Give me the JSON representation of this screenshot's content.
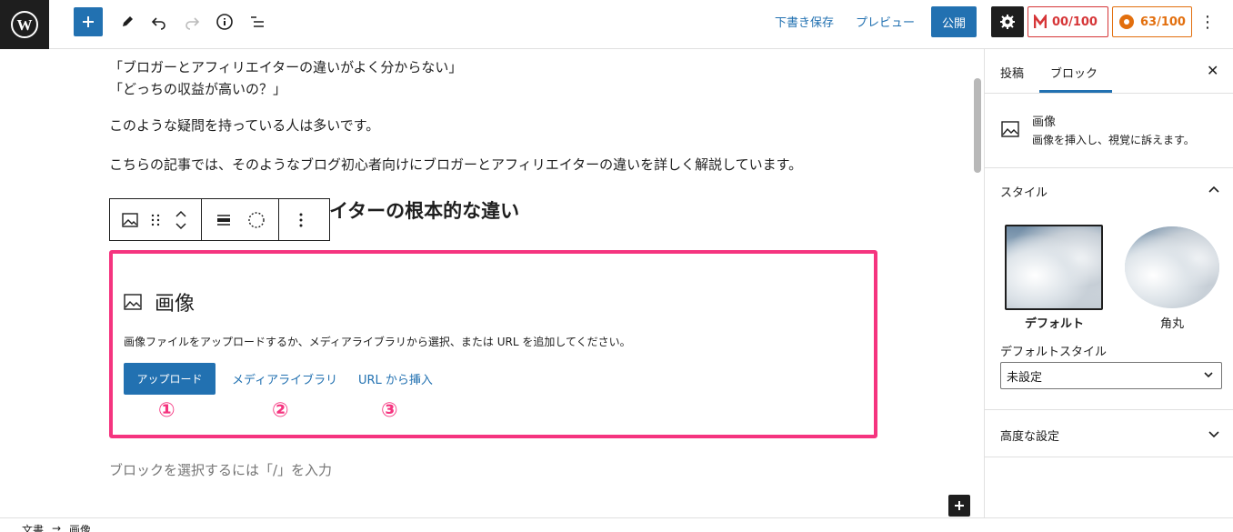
{
  "topbar": {
    "save_draft": "下書き保存",
    "preview": "プレビュー",
    "publish": "公開",
    "score_m": "00/100",
    "score_y": "63/100"
  },
  "content": {
    "lines": [
      "「ブロガーとアフィリエイターの違いがよく分からない」",
      "「どっちの収益が高いの？」",
      "このような疑問を持っている人は多いです。",
      "こちらの記事では、そのようなブログ初心者向けにブロガーとアフィリエイターの違いを詳しく解説しています。"
    ],
    "heading": "イターの根本的な違い",
    "appender": "ブロックを選択するには「/」を入力"
  },
  "image_block": {
    "title": "画像",
    "description": "画像ファイルをアップロードするか、メディアライブラリから選択、または URL を追加してください。",
    "upload": "アップロード",
    "media_library": "メディアライブラリ",
    "insert_url": "URL から挿入",
    "markers": [
      "①",
      "②",
      "③"
    ]
  },
  "sidebar": {
    "tab_post": "投稿",
    "tab_block": "ブロック",
    "block_name": "画像",
    "block_desc": "画像を挿入し、視覚に訴えます。",
    "style_panel": "スタイル",
    "style_default": "デフォルト",
    "style_rounded": "角丸",
    "default_style_label": "デフォルトスタイル",
    "default_style_value": "未設定",
    "advanced": "高度な設定"
  },
  "footer": {
    "crumb1": "文書",
    "crumb_sep": "→",
    "crumb2": "画像"
  },
  "colors": {
    "accent": "#2271b1",
    "highlight": "#f5347f",
    "score_m": "#d63638",
    "score_y": "#e26f0e"
  }
}
